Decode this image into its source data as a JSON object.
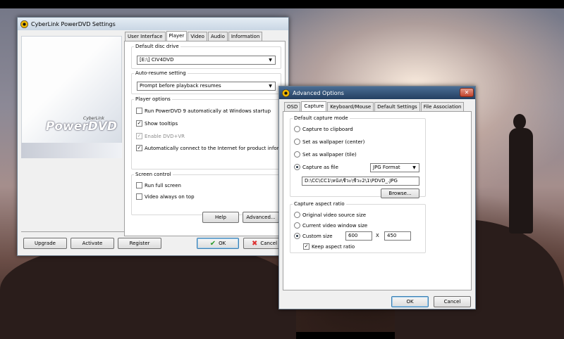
{
  "colors": {
    "title_active": "#243f61",
    "accent": "#3c7fb1"
  },
  "settings_window": {
    "title": "CyberLink PowerDVD Settings",
    "logo": {
      "brand": "CyberLink",
      "product": "PowerDVD"
    },
    "tabs": [
      "User Interface",
      "Player",
      "Video",
      "Audio",
      "Information"
    ],
    "active_tab": "Player",
    "default_disc_drive": {
      "label": "Default disc drive",
      "value": "[E:\\] CIV4DVD"
    },
    "auto_resume": {
      "label": "Auto-resume setting",
      "value": "Prompt before playback resumes"
    },
    "player_options": {
      "label": "Player options",
      "items": [
        {
          "label": "Run PowerDVD 9 automatically at Windows startup",
          "checked": false,
          "enabled": true
        },
        {
          "label": "Show tooltips",
          "checked": true,
          "enabled": true
        },
        {
          "label": "Enable DVD+VR",
          "checked": true,
          "enabled": false
        },
        {
          "label": "Automatically connect to the Internet for product information",
          "checked": true,
          "enabled": true
        }
      ]
    },
    "screen_control": {
      "label": "Screen control",
      "items": [
        {
          "label": "Run full screen",
          "checked": false
        },
        {
          "label": "Video always on top",
          "checked": false
        }
      ]
    },
    "buttons": {
      "help": "Help",
      "advanced": "Advanced...",
      "upgrade": "Upgrade",
      "activate": "Activate",
      "register": "Register",
      "ok": "OK",
      "cancel": "Cancel"
    }
  },
  "advanced_window": {
    "title": "Advanced Options",
    "tabs": [
      "OSD",
      "Capture",
      "Keyboard/Mouse",
      "Default Settings",
      "File Association"
    ],
    "active_tab": "Capture",
    "capture_mode": {
      "label": "Default capture mode",
      "options": [
        "Capture to clipboard",
        "Set as wallpaper (center)",
        "Set as wallpaper (tile)",
        "Capture as file"
      ],
      "selected": "Capture as file",
      "format": "JPG Format",
      "file_path": "D:\\CC\\CC1\\หนัง\\ชีวะ\\ชีวะ2\\1\\PDVD_.JPG",
      "browse": "Browse..."
    },
    "aspect_ratio": {
      "label": "Capture aspect ratio",
      "options": [
        "Original video source size",
        "Current video window size",
        "Custom size"
      ],
      "selected": "Custom size",
      "width": "600",
      "times": "X",
      "height": "450",
      "keep_aspect": {
        "label": "Keep aspect ratio",
        "checked": true
      }
    },
    "buttons": {
      "ok": "OK",
      "cancel": "Cancel"
    }
  }
}
